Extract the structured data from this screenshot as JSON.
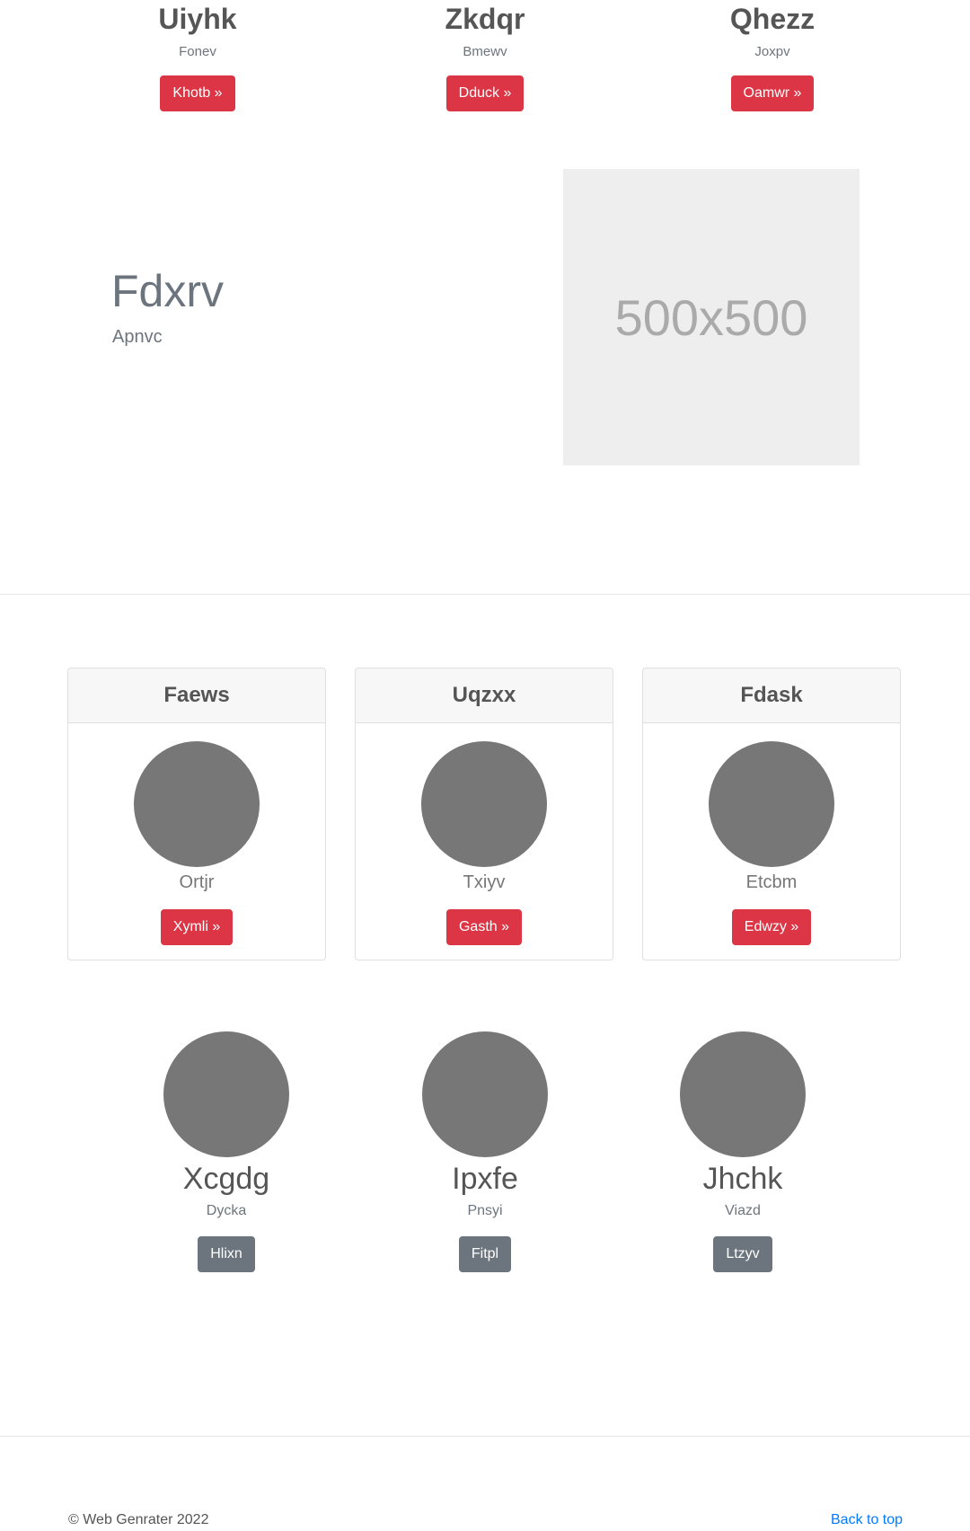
{
  "top_features": [
    {
      "title": "Uiyhk",
      "subtitle": "Fonev",
      "button": "Khotb »"
    },
    {
      "title": "Zkdqr",
      "subtitle": "Bmewv",
      "button": "Dduck »"
    },
    {
      "title": "Qhezz",
      "subtitle": "Joxpv",
      "button": "Oamwr »"
    }
  ],
  "featurette": {
    "title": "Fdxrv",
    "subtitle": "Apnvc",
    "image_label": "500x500"
  },
  "cards": [
    {
      "header": "Faews",
      "subtitle": "Ortjr",
      "button": "Xymli »"
    },
    {
      "header": "Uqzxx",
      "subtitle": "Txiyv",
      "button": "Gasth »"
    },
    {
      "header": "Fdask",
      "subtitle": "Etcbm",
      "button": "Edwzy »"
    }
  ],
  "people": [
    {
      "name": "Xcgdg",
      "subtitle": "Dycka",
      "button": "Hlixn"
    },
    {
      "name": "Ipxfe",
      "subtitle": "Pnsyi",
      "button": "Fitpl"
    },
    {
      "name": "Jhchk",
      "subtitle": "Viazd",
      "button": "Ltzyv"
    }
  ],
  "footer": {
    "copyright": "© Web Genrater 2022",
    "back_to_top": "Back to top"
  },
  "colors": {
    "primary_button": "#dc3545",
    "secondary_button": "#6c757d",
    "avatar": "#777777",
    "link": "#007bff"
  }
}
